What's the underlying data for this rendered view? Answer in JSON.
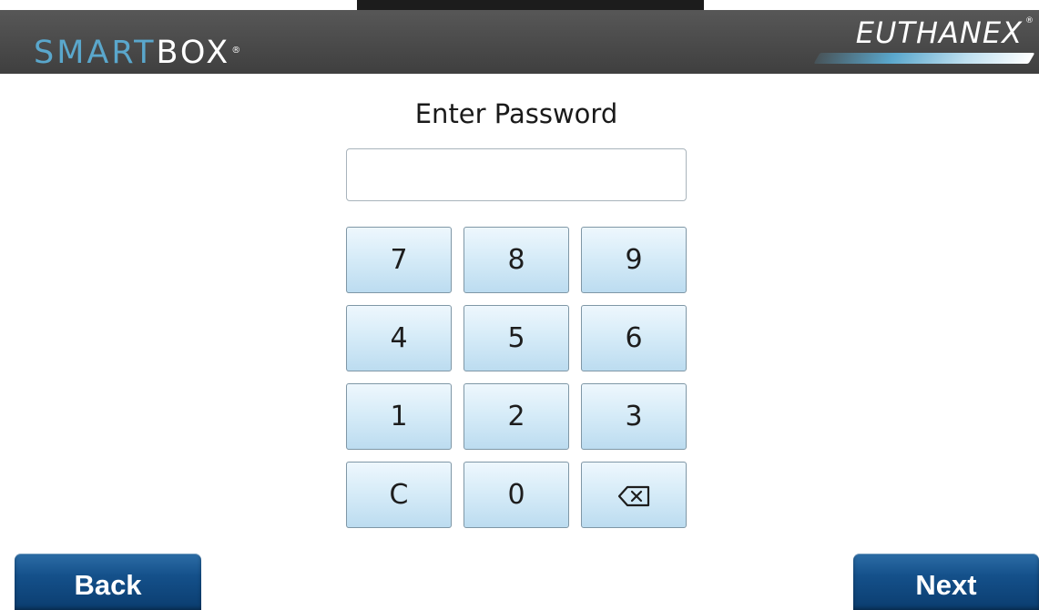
{
  "header": {
    "logo_left_part1": "SMART",
    "logo_left_part2": "BOX",
    "logo_left_reg": "®",
    "logo_right": "EUTHANEX",
    "logo_right_reg": "®"
  },
  "colors": {
    "header_bg": "#4a4a4a",
    "logo_accent": "#5aa7cc",
    "key_bg": "#d7ecf8",
    "button_bg": "#14508a"
  },
  "title": "Enter Password",
  "password": {
    "value": "",
    "placeholder": ""
  },
  "keypad": {
    "keys": [
      "7",
      "8",
      "9",
      "4",
      "5",
      "6",
      "1",
      "2",
      "3",
      "C",
      "0"
    ],
    "backspace_icon": "backspace-icon"
  },
  "footer": {
    "back_label": "Back",
    "next_label": "Next"
  }
}
